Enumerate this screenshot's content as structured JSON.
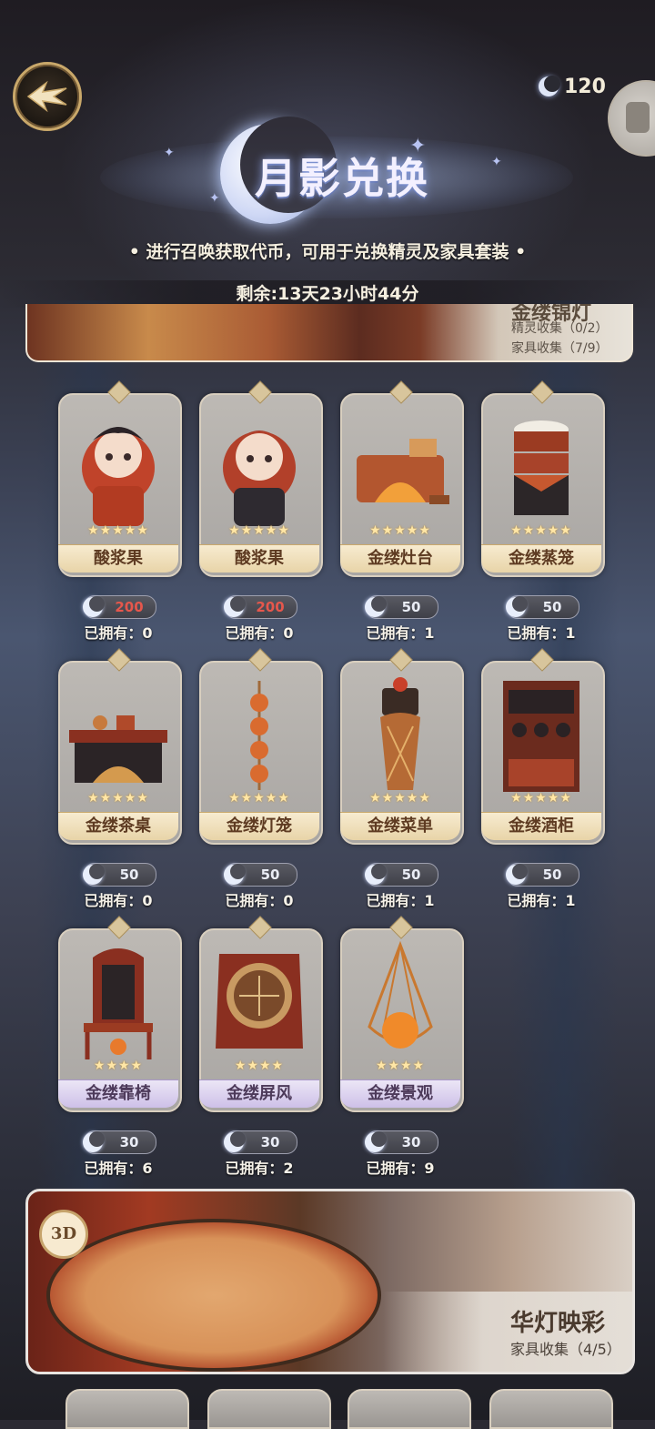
{
  "header": {
    "currency_amount": "120",
    "title": "月影兑换",
    "subtitle": "• 进行召唤获取代币，可用于兑换精灵及家具套装 •",
    "remaining": "剩余:13天23小时44分"
  },
  "top_banner": {
    "name": "金缕锦灯",
    "spirit_collect": "精灵收集（0/2）",
    "furniture_collect": "家具收集（7/9）"
  },
  "items": [
    {
      "name": "酸浆果",
      "stars": "★★★★★",
      "price": "200",
      "price_color": "#e6574c",
      "owned": "已拥有：0",
      "tier": "gold"
    },
    {
      "name": "酸浆果",
      "stars": "★★★★★",
      "price": "200",
      "price_color": "#e6574c",
      "owned": "已拥有：0",
      "tier": "gold"
    },
    {
      "name": "金缕灶台",
      "stars": "★★★★★",
      "price": "50",
      "price_color": "#e9ecf5",
      "owned": "已拥有：1",
      "tier": "gold"
    },
    {
      "name": "金缕蒸笼",
      "stars": "★★★★★",
      "price": "50",
      "price_color": "#e9ecf5",
      "owned": "已拥有：1",
      "tier": "gold"
    },
    {
      "name": "金缕茶桌",
      "stars": "★★★★★",
      "price": "50",
      "price_color": "#e9ecf5",
      "owned": "已拥有：0",
      "tier": "gold"
    },
    {
      "name": "金缕灯笼",
      "stars": "★★★★★",
      "price": "50",
      "price_color": "#e9ecf5",
      "owned": "已拥有：0",
      "tier": "gold"
    },
    {
      "name": "金缕菜单",
      "stars": "★★★★★",
      "price": "50",
      "price_color": "#e9ecf5",
      "owned": "已拥有：1",
      "tier": "gold"
    },
    {
      "name": "金缕酒柜",
      "stars": "★★★★★",
      "price": "50",
      "price_color": "#e9ecf5",
      "owned": "已拥有：1",
      "tier": "gold"
    },
    {
      "name": "金缕靠椅",
      "stars": "★★★★",
      "price": "30",
      "price_color": "#e9ecf5",
      "owned": "已拥有：6",
      "tier": "purple"
    },
    {
      "name": "金缕屏风",
      "stars": "★★★★",
      "price": "30",
      "price_color": "#e9ecf5",
      "owned": "已拥有：2",
      "tier": "purple"
    },
    {
      "name": "金缕景观",
      "stars": "★★★★",
      "price": "30",
      "price_color": "#e9ecf5",
      "owned": "已拥有：9",
      "tier": "purple"
    }
  ],
  "bottom_banner": {
    "badge": "3D",
    "title": "华灯映彩",
    "collect": "家具收集（4/5）"
  },
  "icons": {
    "back": "back-arrow-icon",
    "currency": "moon-coin-icon",
    "side": "menu-icon"
  }
}
